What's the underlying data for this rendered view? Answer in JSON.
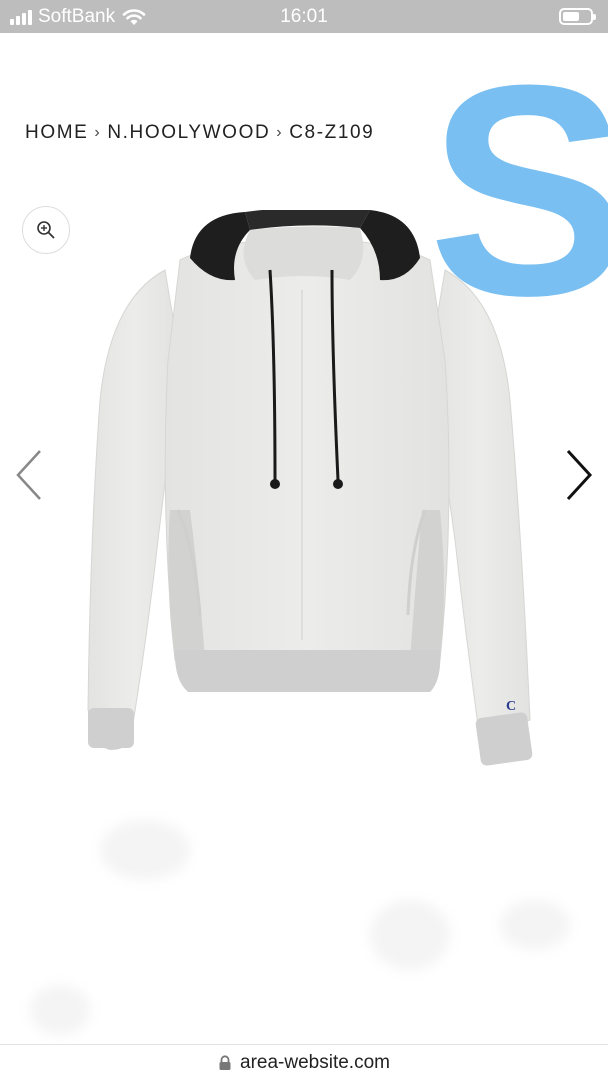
{
  "status_bar": {
    "carrier": "SoftBank",
    "time": "16:01"
  },
  "breadcrumb": {
    "items": [
      "HOME",
      "N.HOOLYWOOD",
      "C8-Z109"
    ],
    "separator": "›"
  },
  "size_mark": {
    "text": "S",
    "color": "#79bff2"
  },
  "url_bar": {
    "url": "area-website.com"
  },
  "icons": {
    "zoom": "zoom-in-icon",
    "prev": "chevron-left-icon",
    "next": "chevron-right-icon",
    "lock": "lock-icon",
    "wifi": "wifi-icon",
    "signal": "signal-icon",
    "battery": "battery-icon"
  },
  "colors": {
    "status_bar_bg": "#bdbdbd",
    "accent_blue": "#79bff2",
    "hoodie_body": "#e8e8e6",
    "hoodie_hood": "#1e1e1e",
    "hoodie_rib": "#cfcfcf"
  }
}
